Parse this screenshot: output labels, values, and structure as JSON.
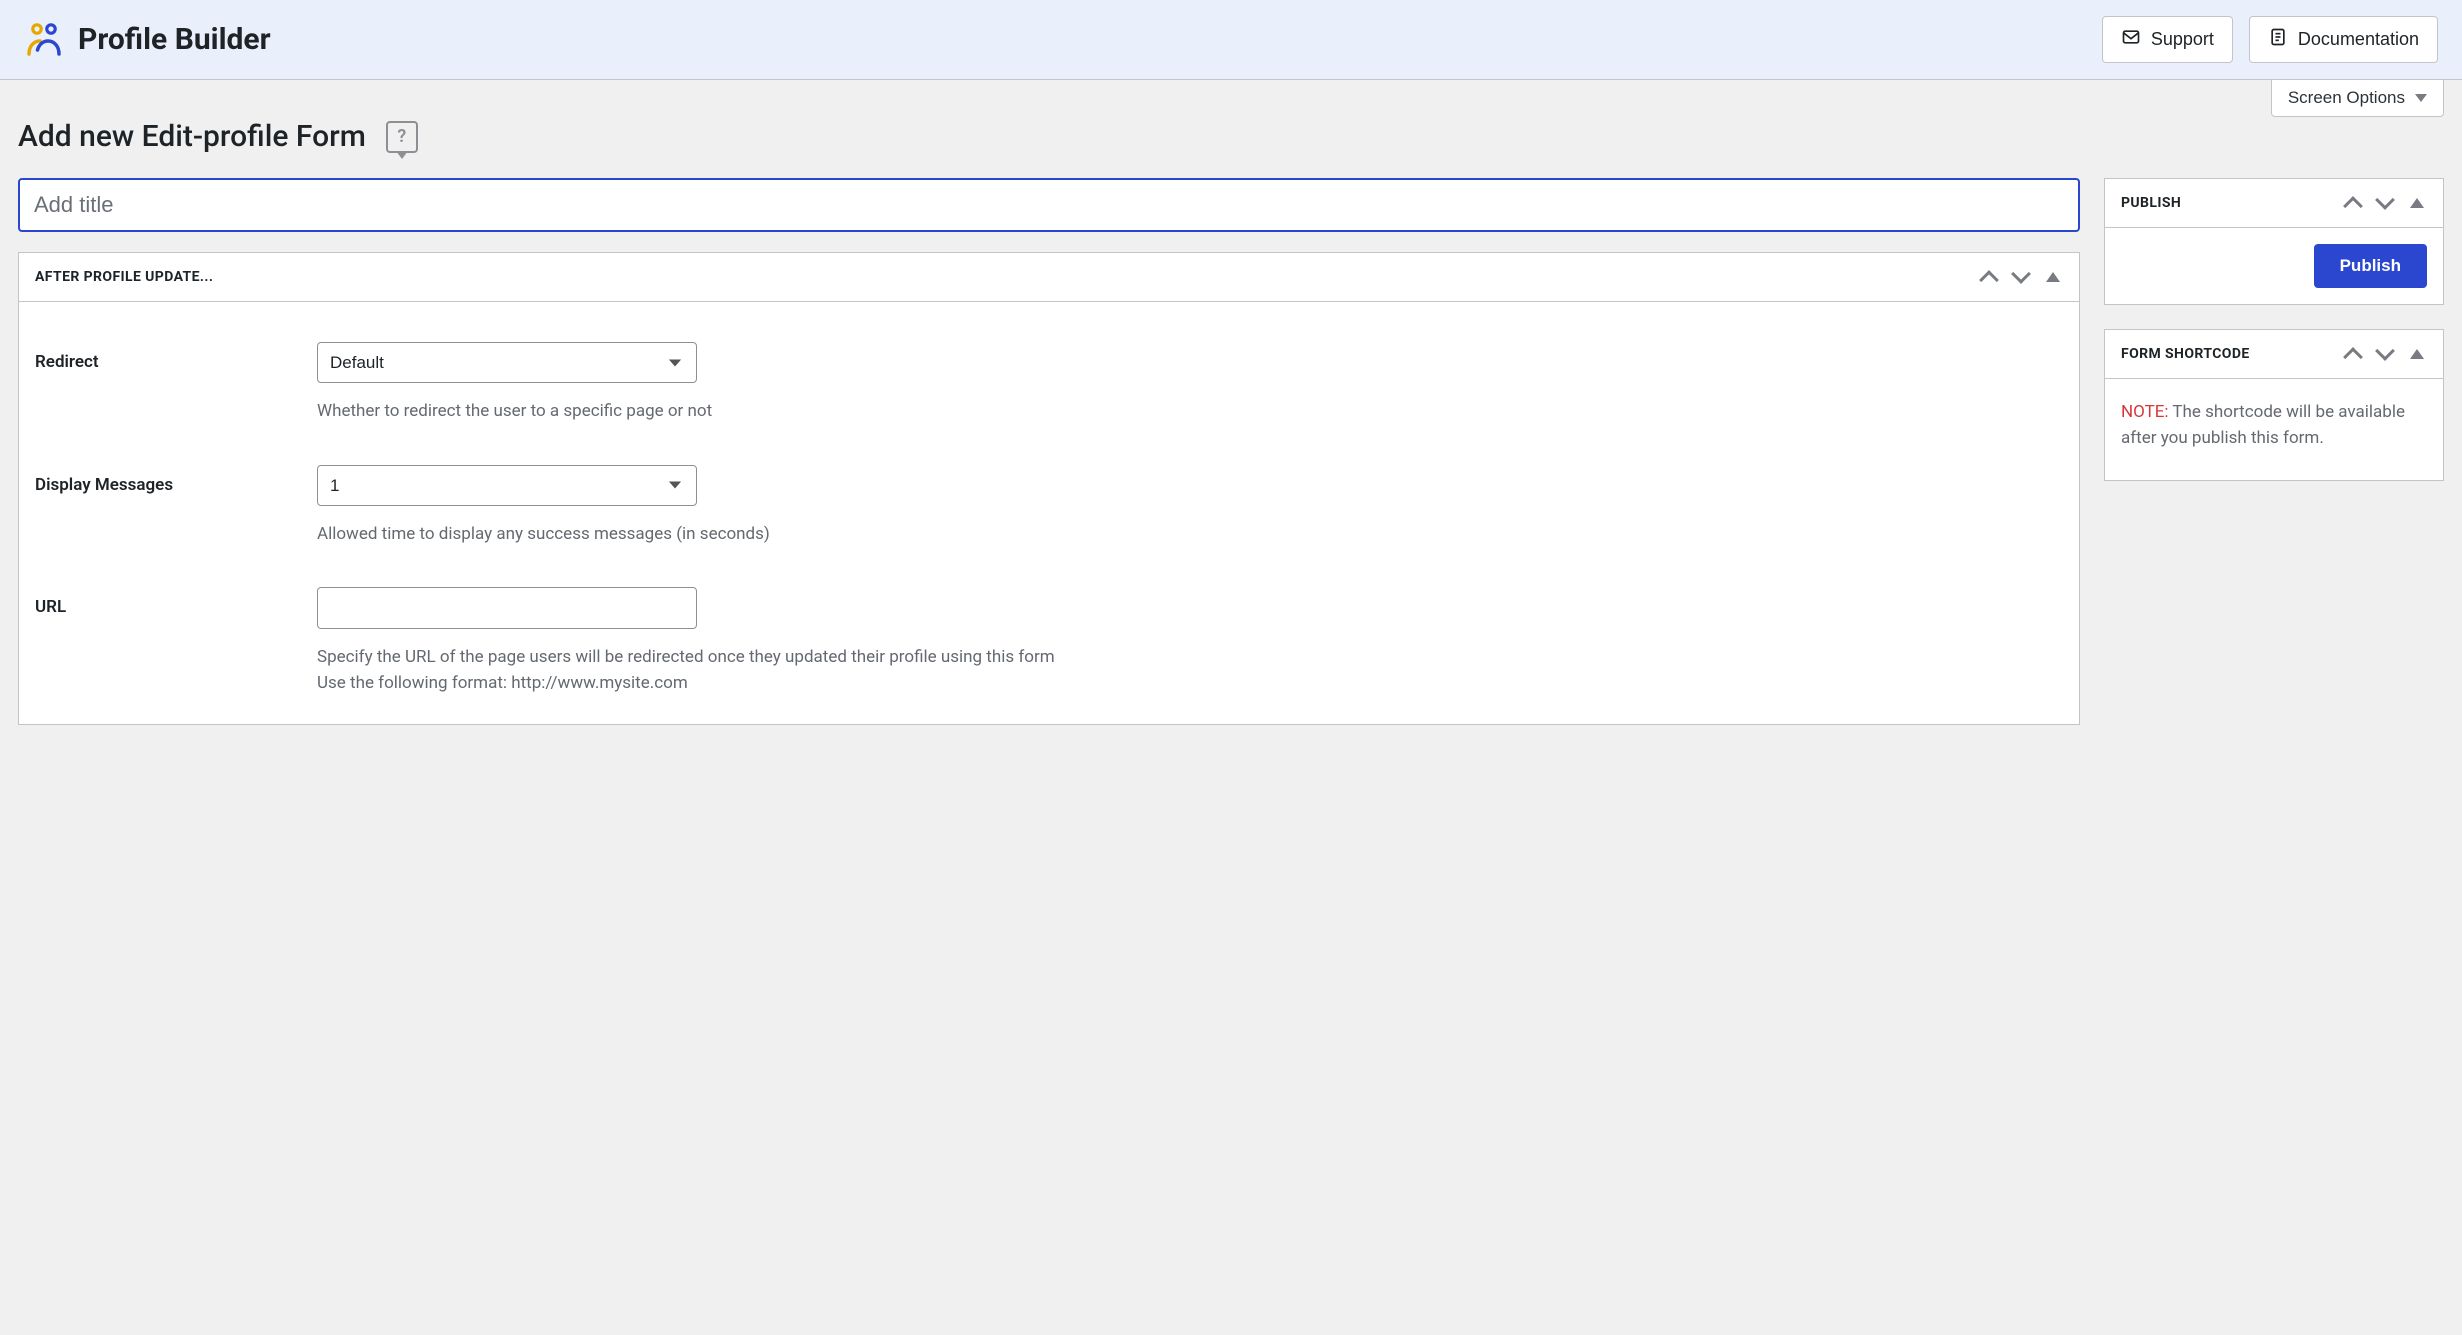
{
  "banner": {
    "title": "Profile Builder",
    "support_label": "Support",
    "documentation_label": "Documentation"
  },
  "screen_options_label": "Screen Options",
  "page_heading": "Add new Edit-profile Form",
  "title_input": {
    "placeholder": "Add title",
    "value": ""
  },
  "metaboxes": {
    "after_update": {
      "title": "AFTER PROFILE UPDATE...",
      "fields": {
        "redirect": {
          "label": "Redirect",
          "value": "Default",
          "desc": "Whether to redirect the user to a specific page or not"
        },
        "display_messages": {
          "label": "Display Messages",
          "value": "1",
          "desc": "Allowed time to display any success messages (in seconds)"
        },
        "url": {
          "label": "URL",
          "value": "",
          "desc_line1": "Specify the URL of the page users will be redirected once they updated their profile using this form",
          "desc_line2": "Use the following format: http://www.mysite.com"
        }
      }
    },
    "publish": {
      "title": "PUBLISH",
      "button": "Publish"
    },
    "shortcode": {
      "title": "FORM SHORTCODE",
      "note_label": "NOTE:",
      "note_text": " The shortcode will be available after you publish this form."
    }
  }
}
